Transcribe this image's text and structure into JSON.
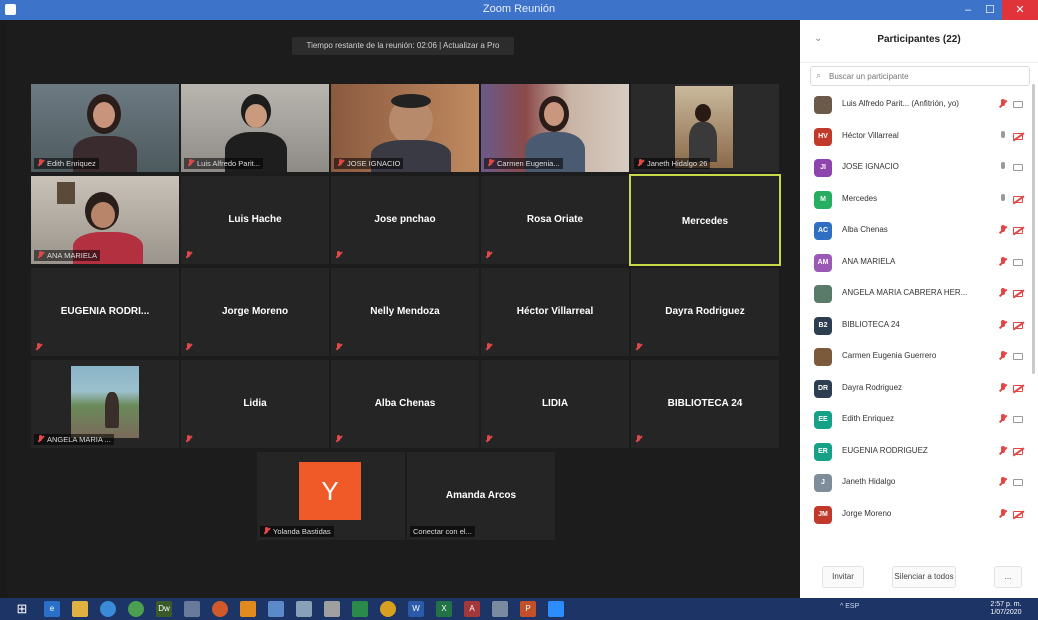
{
  "window": {
    "title": "Zoom Reunión"
  },
  "timer": {
    "text": "Tiempo restante de la reunión: 02:06 | Actualizar a Pro"
  },
  "video_tiles": [
    {
      "label": "Edith Enriquez"
    },
    {
      "label": "Luis Alfredo Parit..."
    },
    {
      "label": "JOSE IGNACIO"
    },
    {
      "label": "Carmen Eugenia..."
    },
    {
      "label": "Janeth Hidalgo 26"
    },
    {
      "label": "ANA MARIELA"
    },
    {
      "name": "Luis Hache"
    },
    {
      "name": "Jose pnchao"
    },
    {
      "name": "Rosa Oriate"
    },
    {
      "name": "Mercedes"
    },
    {
      "name": "EUGENIA RODRI..."
    },
    {
      "name": "Jorge Moreno"
    },
    {
      "name": "Nelly Mendoza"
    },
    {
      "name": "Héctor Villarreal"
    },
    {
      "name": "Dayra Rodriguez"
    },
    {
      "label": "ANGELA MARIA ..."
    },
    {
      "name": "Lidia"
    },
    {
      "name": "Alba Chenas"
    },
    {
      "name": "LIDIA"
    },
    {
      "name": "BIBLIOTECA 24"
    },
    {
      "label": "Yolanda Bastidas",
      "initial": "Y"
    },
    {
      "name": "Amanda Arcos",
      "label": "Conectar con el..."
    }
  ],
  "panel": {
    "title": "Participantes (22)",
    "search_placeholder": "Buscar un participante",
    "participants": [
      {
        "name": "Luis Alfredo Parit... (Anfitrión, yo)",
        "initials": "",
        "color": "#6b5a4a",
        "mic": "red",
        "cam": "on"
      },
      {
        "name": "Héctor Villarreal",
        "initials": "HV",
        "color": "#c0392b",
        "mic": "on",
        "cam": "off"
      },
      {
        "name": "JOSE IGNACIO",
        "initials": "JI",
        "color": "#8e44ad",
        "mic": "on",
        "cam": "on"
      },
      {
        "name": "Mercedes",
        "initials": "M",
        "color": "#27ae60",
        "mic": "on",
        "cam": "off"
      },
      {
        "name": "Alba Chenas",
        "initials": "AC",
        "color": "#2e6fc4",
        "mic": "red",
        "cam": "off"
      },
      {
        "name": "ANA MARIELA",
        "initials": "AM",
        "color": "#9b59b6",
        "mic": "red",
        "cam": "on"
      },
      {
        "name": "ANGELA MARIA CABRERA HER...",
        "initials": "",
        "color": "#5a7a6a",
        "mic": "red",
        "cam": "off"
      },
      {
        "name": "BIBLIOTECA 24",
        "initials": "B2",
        "color": "#2c3e50",
        "mic": "red",
        "cam": "off"
      },
      {
        "name": "Carmen Eugenia Guerrero",
        "initials": "",
        "color": "#7a5a3a",
        "mic": "red",
        "cam": "on"
      },
      {
        "name": "Dayra Rodriguez",
        "initials": "DR",
        "color": "#2c3e50",
        "mic": "red",
        "cam": "off"
      },
      {
        "name": "Edith Enriquez",
        "initials": "EE",
        "color": "#16a085",
        "mic": "red",
        "cam": "on"
      },
      {
        "name": "EUGENIA RODRIGUEZ",
        "initials": "ER",
        "color": "#16a085",
        "mic": "red",
        "cam": "off"
      },
      {
        "name": "Janeth Hidalgo",
        "initials": "J",
        "color": "#7f8c9a",
        "mic": "red",
        "cam": "on"
      },
      {
        "name": "Jorge Moreno",
        "initials": "JM",
        "color": "#c0392b",
        "mic": "red",
        "cam": "off"
      }
    ],
    "invite_label": "Invitar",
    "mute_all_label": "Silenciar a todos",
    "more_label": "..."
  },
  "taskbar": {
    "tray_text": "^ ESP",
    "clock_time": "2:57 p. m.",
    "clock_date": "1/07/2020"
  }
}
